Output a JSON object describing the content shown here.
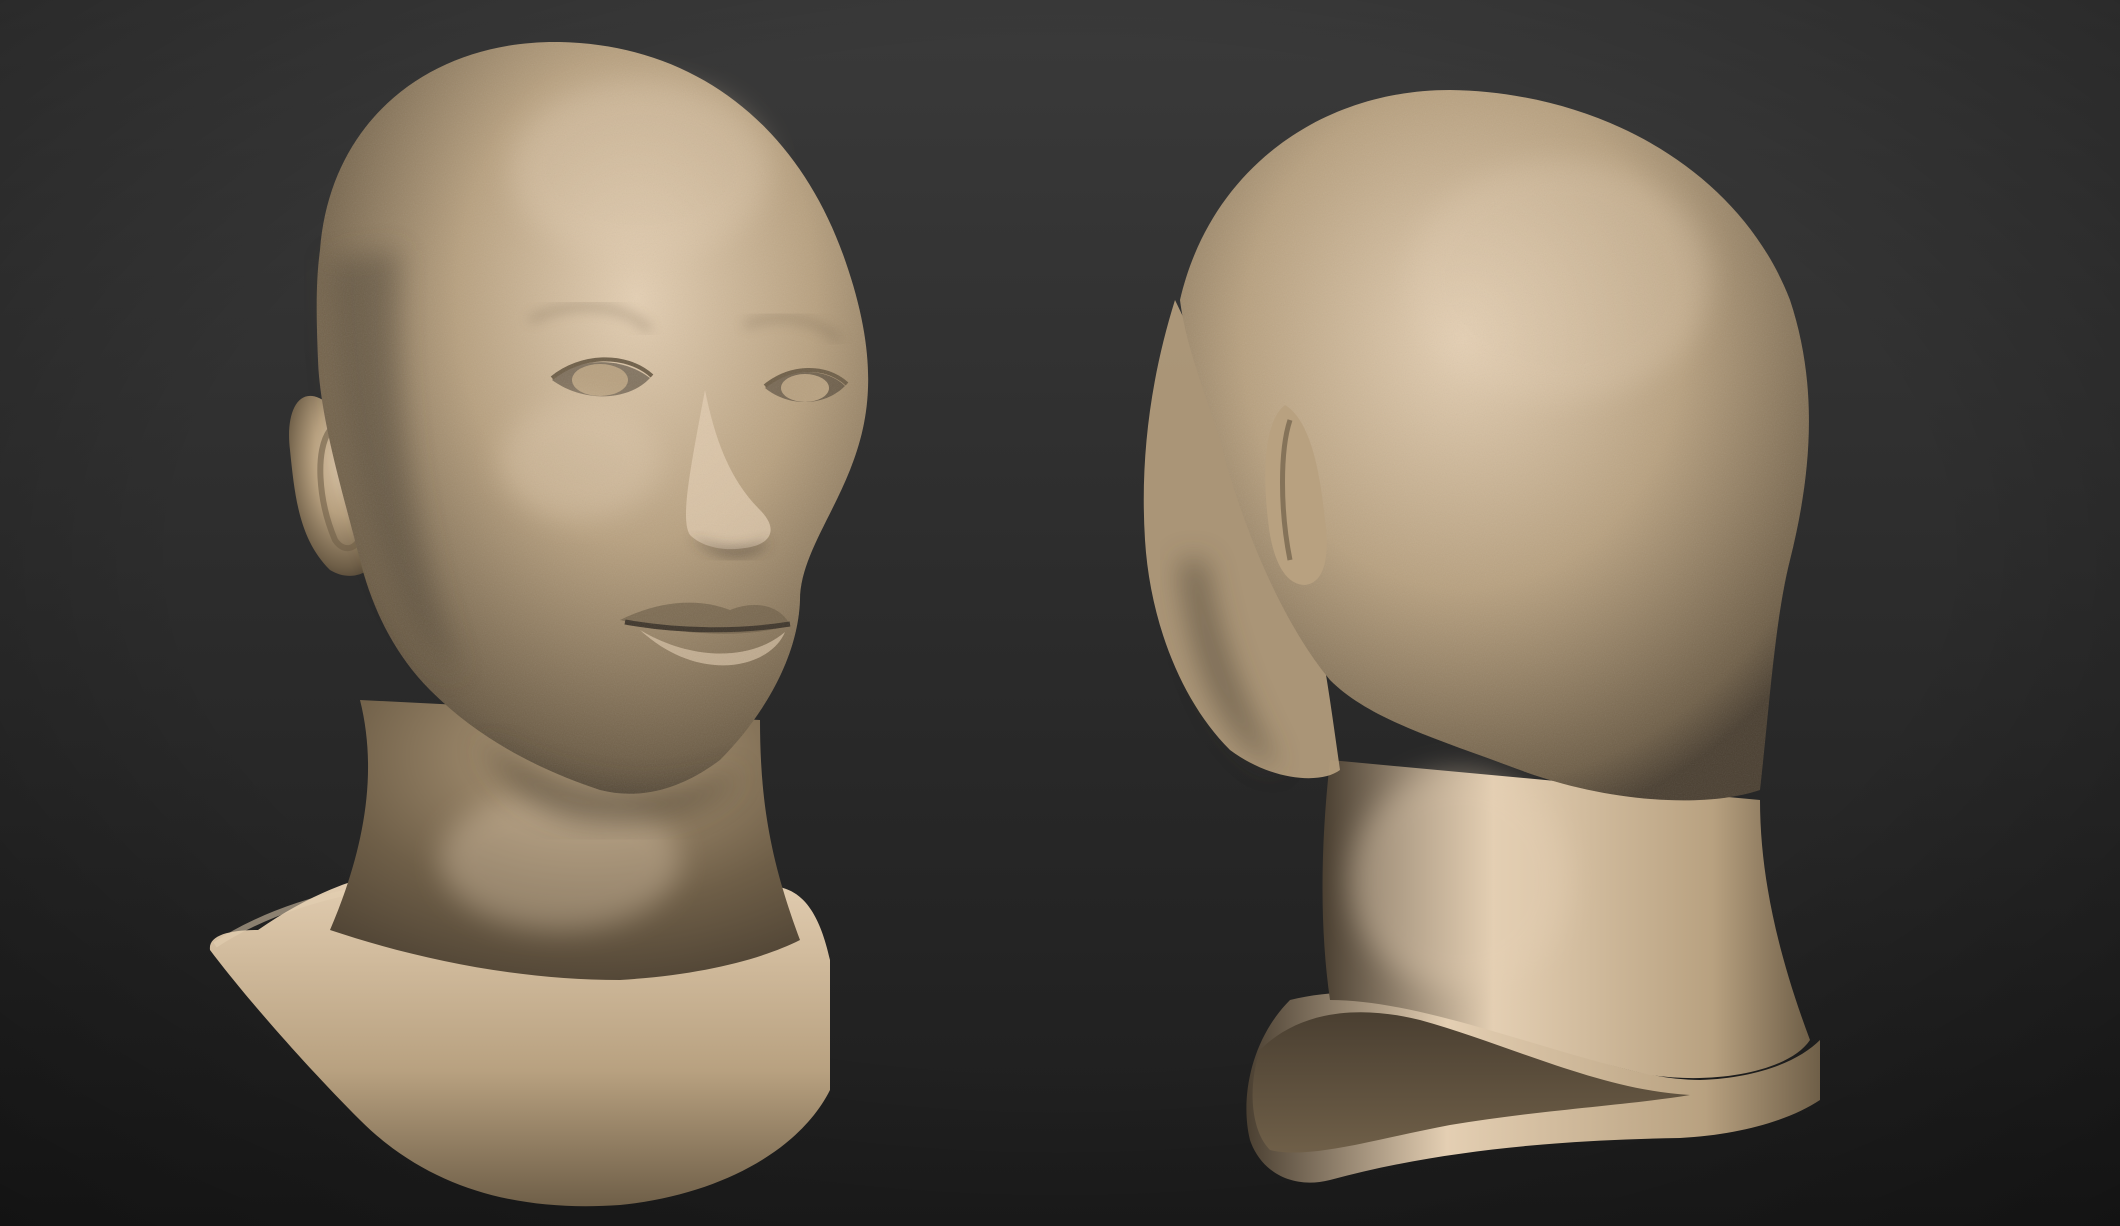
{
  "scene": {
    "kind": "3d-sculpt-render",
    "views": [
      "front-three-quarter",
      "rear-three-quarter"
    ],
    "material": "clay",
    "colors": {
      "background_top": "#3a3a3a",
      "background_bottom": "#1d1d1d",
      "clay_light": "#e4cfb3",
      "clay_mid": "#b8a180",
      "clay_dark": "#6f5f48",
      "clay_shadow": "#4a3f31",
      "cavity": "#3f362b"
    }
  }
}
